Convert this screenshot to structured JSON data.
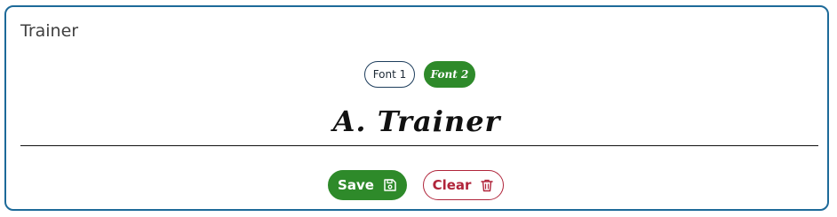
{
  "card": {
    "title": "Trainer"
  },
  "font_options": [
    {
      "label": "Font 1",
      "selected": false
    },
    {
      "label": "Font 2",
      "selected": true
    }
  ],
  "signature": {
    "text": "A. Trainer"
  },
  "actions": {
    "save_label": "Save",
    "save_icon": "floppy-disk-icon",
    "clear_label": "Clear",
    "clear_icon": "trash-icon"
  },
  "colors": {
    "border": "#1d6a99",
    "primary_green": "#2e8a2a",
    "danger_red": "#b0243a"
  }
}
